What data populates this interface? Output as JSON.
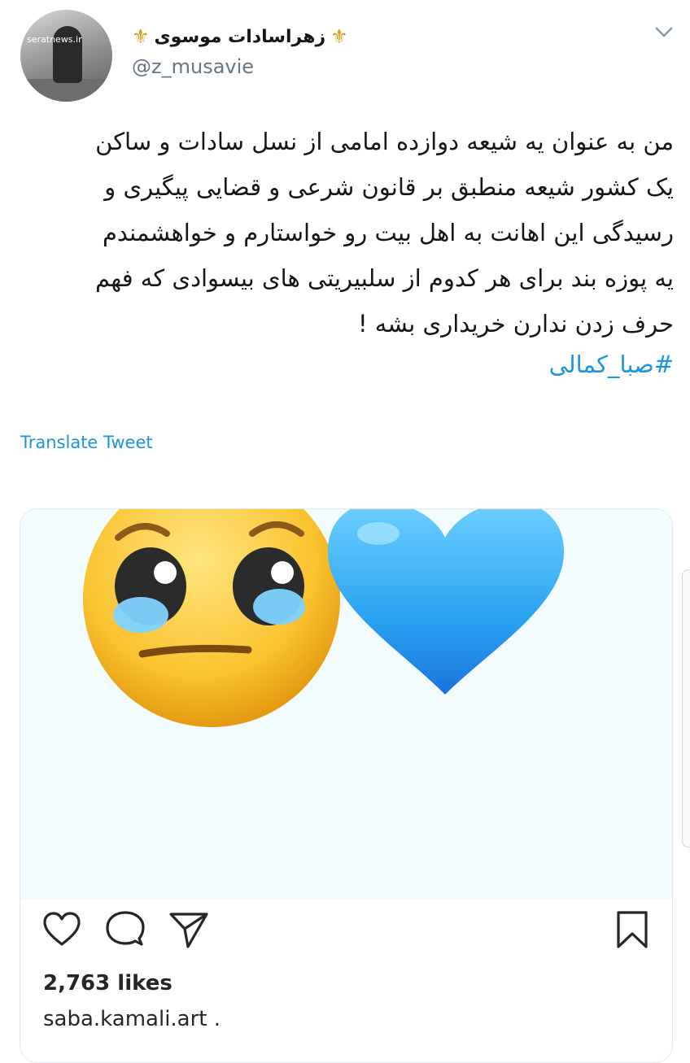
{
  "author": {
    "display_name": "زهراسادات موسوی",
    "name_emoji": "⚜",
    "handle": "@z_musavie",
    "avatar_watermark": "seratnews.ir"
  },
  "tweet": {
    "lines": [
      "من به عنوان یه شیعه دوازده امامی از نسل سادات و ساکن",
      "یک کشور شیعه منطبق بر قانون شرعی و قضایی پیگیری و",
      "رسیدگی این اهانت به اهل بیت رو خواستارم و خواهشمندم",
      "یه پوزه بند برای هر کدوم از سلبیریتی های بیسوادی که فهم",
      "حرف زدن ندارن خریداری بشه !"
    ],
    "hashtag": "#صبا_کمالی",
    "translate_label": "Translate Tweet"
  },
  "embedded_post": {
    "media_emojis": [
      "pleading-face-tears",
      "blue-heart"
    ],
    "likes": "2,763 likes",
    "owner_caption": "saba.kamali.art ."
  },
  "colors": {
    "link": "#1b95e0",
    "handle": "#657786",
    "border": "#e1e8ed",
    "heart": "#1e9af0"
  }
}
